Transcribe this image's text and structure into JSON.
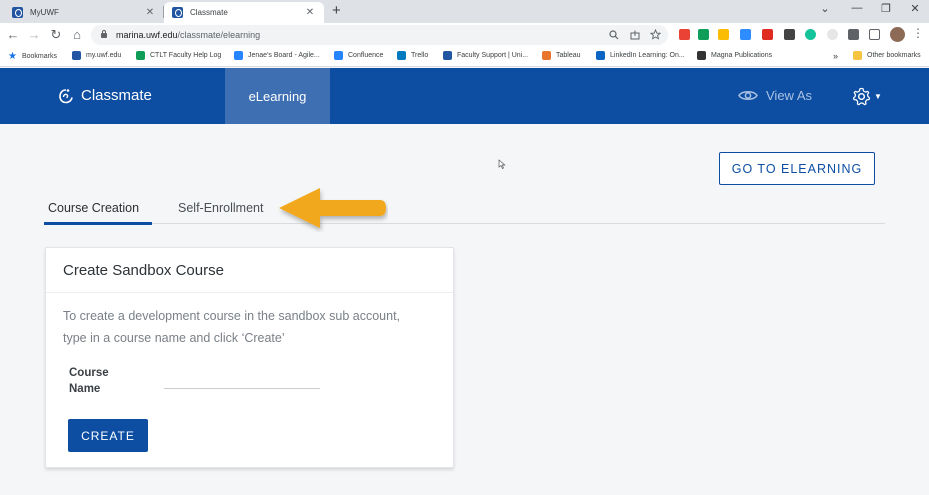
{
  "browser": {
    "tabs": [
      {
        "title": "MyUWF",
        "close": "✕"
      },
      {
        "title": "Classmate",
        "close": "✕"
      }
    ],
    "new_tab": "+",
    "window_controls": [
      "⌄",
      "—",
      "❐",
      "✕"
    ],
    "nav": {
      "back": "←",
      "forward": "→",
      "reload": "↻",
      "home": "⌂"
    },
    "url_host": "marina.uwf.edu",
    "url_path": "/classmate/elearning",
    "bookmarks_label": "Bookmarks",
    "bookmarks": [
      {
        "label": "my.uwf.edu",
        "color": "#2256a3"
      },
      {
        "label": "CTLT Faculty Help Log",
        "color": "#0f9d58"
      },
      {
        "label": "Jenae's Board - Agile...",
        "color": "#2684ff"
      },
      {
        "label": "Confluence",
        "color": "#2684ff"
      },
      {
        "label": "Trello",
        "color": "#0079bf"
      },
      {
        "label": "Faculty Support | Uni...",
        "color": "#2256a3"
      },
      {
        "label": "Tableau",
        "color": "#e8762d"
      },
      {
        "label": "LinkedIn Learning: On...",
        "color": "#0a66c2"
      },
      {
        "label": "Magna Publications",
        "color": "#333333"
      }
    ],
    "overflow": "»",
    "other_bookmarks": "Other bookmarks"
  },
  "app": {
    "brand": "Classmate",
    "active_tab": "eLearning",
    "view_as": "View As",
    "colors": {
      "header": "#0d4ea3",
      "active_tab": "#3e6fb2",
      "accent": "#0d4ea3",
      "arrow": "#f2a81d"
    }
  },
  "main": {
    "goto_button": "GO TO ELEARNING",
    "tabs": [
      {
        "label": "Course Creation",
        "selected": true
      },
      {
        "label": "Self-Enrollment",
        "selected": false
      }
    ],
    "card": {
      "title": "Create Sandbox Course",
      "description": "To create a development course in the sandbox sub account, type in a course name and click ‘Create’",
      "field_label": "Course Name",
      "field_value": "",
      "button": "CREATE"
    }
  }
}
